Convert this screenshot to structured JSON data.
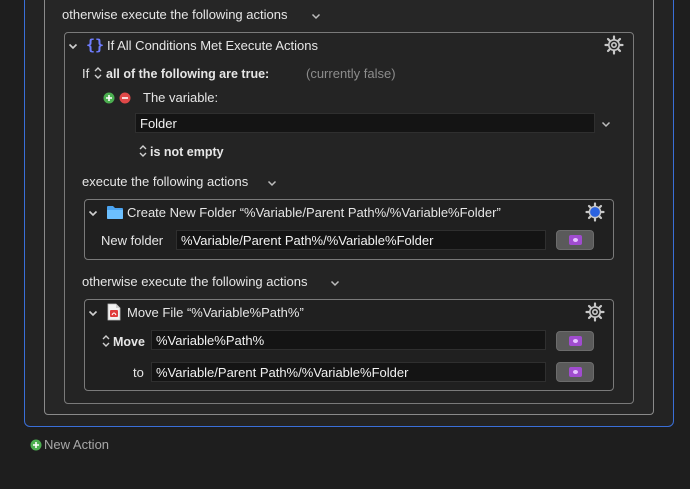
{
  "outer": {
    "otherwise_label": "otherwise execute the following actions"
  },
  "if_action": {
    "title": "If All Conditions Met Execute Actions",
    "if_prefix": "If",
    "match_mode": "all of the following are true:",
    "status": "(currently false)",
    "condition": {
      "type_label": "The variable:",
      "variable_value": "Folder",
      "operator": "is not empty"
    },
    "then_label": "execute the following actions",
    "else_label": "otherwise execute the following actions"
  },
  "create_folder": {
    "title": "Create New Folder “%Variable/Parent Path%/%Variable%Folder”",
    "field_label": "New folder",
    "field_value": "%Variable/Parent Path%/%Variable%Folder"
  },
  "move_file": {
    "title": "Move File “%Variable%Path%”",
    "mode_label": "Move",
    "source_value": "%Variable%Path%",
    "to_label": "to",
    "dest_value": "%Variable/Parent Path%/%Variable%Folder"
  },
  "footer": {
    "new_action_label": "New Action"
  },
  "icons": {
    "chevron": "chevron-down-icon",
    "braces": "braces-icon",
    "folder": "folder-icon",
    "file": "pdf-file-icon",
    "gear": "gear-icon",
    "add": "add-circle-icon",
    "remove": "remove-circle-icon",
    "updown": "up-down-stepper-icon",
    "token": "insert-token-icon"
  },
  "colors": {
    "selection_blue": "#3a6fd8",
    "add_green": "#4caf50",
    "remove_red": "#e04848",
    "token_purple": "#a04ccf",
    "braces_blue": "#6f7dff",
    "folder_blue": "#4aa3f0"
  }
}
